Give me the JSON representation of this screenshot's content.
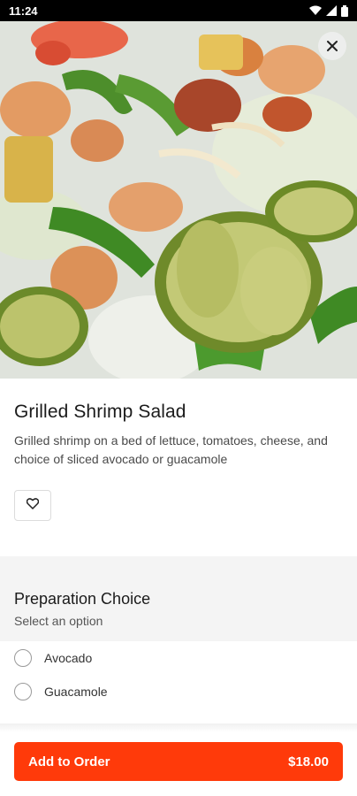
{
  "status_bar": {
    "time": "11:24"
  },
  "hero": {
    "image_alt_icon": "food-photo"
  },
  "item": {
    "title": "Grilled Shrimp Salad",
    "description": "Grilled shrimp on a bed of lettuce, tomatoes, cheese, and choice of sliced avocado or guacamole"
  },
  "preparation": {
    "title": "Preparation Choice",
    "subtitle": "Select an option",
    "options": [
      {
        "label": "Avocado",
        "selected": false
      },
      {
        "label": "Guacamole",
        "selected": false
      }
    ]
  },
  "cta": {
    "label": "Add to Order",
    "price": "$18.00"
  },
  "colors": {
    "accent": "#ff3a0a",
    "section_bg": "#f4f4f4"
  }
}
